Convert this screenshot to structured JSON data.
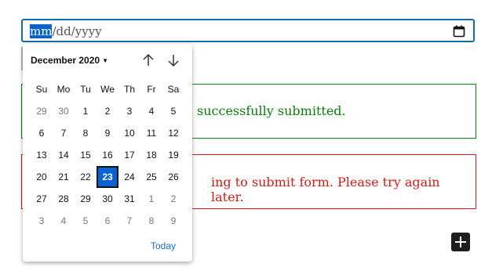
{
  "date_input": {
    "seg_month": "mm",
    "separator1": "/",
    "seg_day": "dd",
    "separator2": "/",
    "seg_year": "yyyy"
  },
  "messages": {
    "success_text": "successfully submitted.",
    "error_text": "ing to submit form. Please try again later."
  },
  "calendar": {
    "month_label": "December 2020",
    "weekdays": [
      "Su",
      "Mo",
      "Tu",
      "We",
      "Th",
      "Fr",
      "Sa"
    ],
    "weeks": [
      [
        "29",
        "30",
        "1",
        "2",
        "3",
        "4",
        "5"
      ],
      [
        "6",
        "7",
        "8",
        "9",
        "10",
        "11",
        "12"
      ],
      [
        "13",
        "14",
        "15",
        "16",
        "17",
        "18",
        "19"
      ],
      [
        "20",
        "21",
        "22",
        "23",
        "24",
        "25",
        "26"
      ],
      [
        "27",
        "28",
        "29",
        "30",
        "31",
        "1",
        "2"
      ],
      [
        "3",
        "4",
        "5",
        "6",
        "7",
        "8",
        "9"
      ]
    ],
    "selected_day": "23",
    "today_label": "Today"
  },
  "colors": {
    "accent": "#0a62d0",
    "success": "#0a7d0a",
    "error": "#d61a1a"
  }
}
